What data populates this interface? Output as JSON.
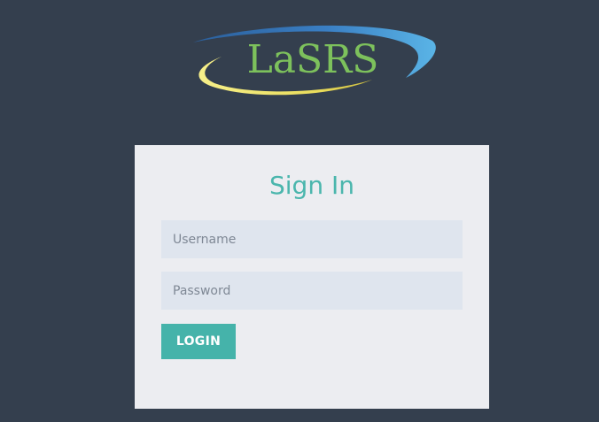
{
  "logo": {
    "text": "LaSRS",
    "icon": "lasrs-logo-icon",
    "colors": {
      "text": "#7dc15c",
      "ring_top": "#4ea4dc",
      "ring_bottom": "#f3ea72"
    }
  },
  "login": {
    "title": "Sign In",
    "username_placeholder": "Username",
    "password_placeholder": "Password",
    "button_label": "LOGIN"
  },
  "colors": {
    "background": "#343f4e",
    "card": "#ecedf1",
    "accent": "#45b3aa",
    "field": "#dfe5ee"
  }
}
